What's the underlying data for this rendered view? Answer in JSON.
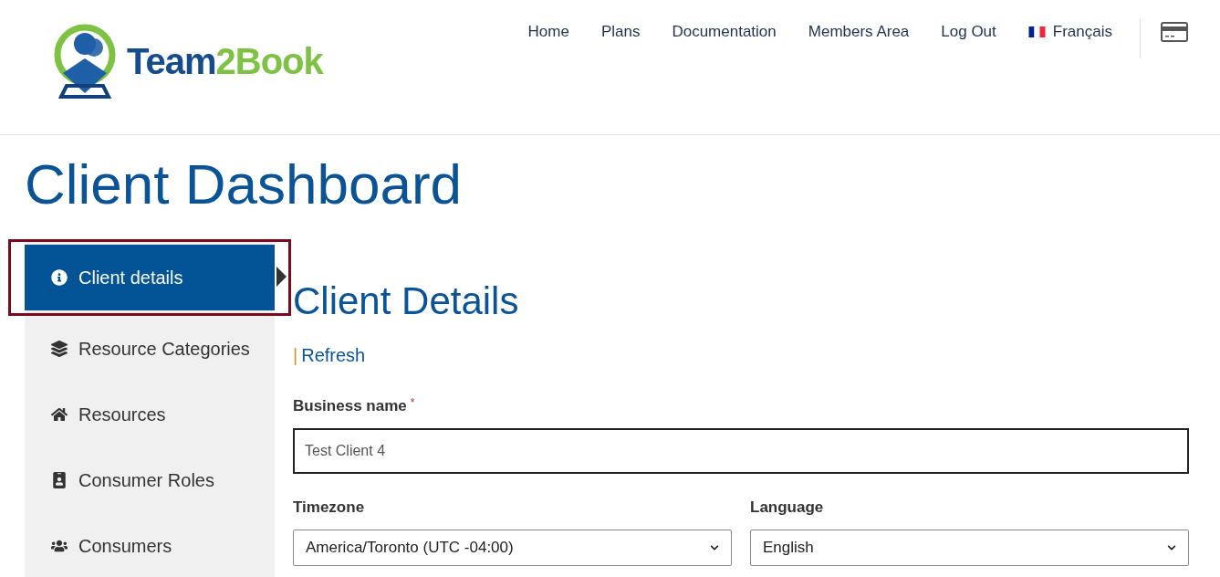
{
  "logo": {
    "part_1": "Team",
    "part_2": "2Book"
  },
  "nav": [
    {
      "label": "Home",
      "kind": "link"
    },
    {
      "label": "Plans",
      "kind": "link"
    },
    {
      "label": "Documentation",
      "kind": "link"
    },
    {
      "label": "Members Area",
      "kind": "link"
    },
    {
      "label": "Log Out",
      "kind": "link"
    },
    {
      "label": "Français",
      "kind": "language"
    }
  ],
  "page_title": "Client Dashboard",
  "sidebar": {
    "items": [
      {
        "label": "Client details",
        "kind": "info",
        "selected": true
      },
      {
        "label": "Resource Categories",
        "kind": "layers",
        "selected": false
      },
      {
        "label": "Resources",
        "kind": "home",
        "selected": false
      },
      {
        "label": "Consumer Roles",
        "kind": "badge",
        "selected": false
      },
      {
        "label": "Consumers",
        "kind": "users",
        "selected": false
      }
    ]
  },
  "content": {
    "title": "Client Details",
    "separator": "|",
    "refresh": "Refresh",
    "business_name": {
      "label": "Business name",
      "required_mark": "*",
      "value": "Test Client 4"
    },
    "timezone": {
      "label": "Timezone",
      "value": "America/Toronto (UTC -04:00)"
    },
    "language": {
      "label": "Language",
      "value": "English"
    }
  }
}
